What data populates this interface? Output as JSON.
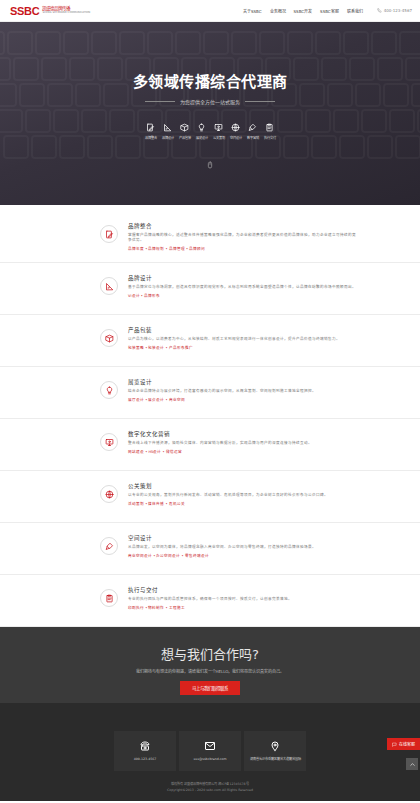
{
  "header": {
    "logo": "SSBC",
    "brand": "凯盛德品牌传播",
    "slogan": "SHENG SHI BRAND COMMUNICATION",
    "nav": [
      {
        "label": "关于SSBC"
      },
      {
        "label": "业务概况"
      },
      {
        "label": "SSBC开发"
      },
      {
        "label": "SSBC客服"
      },
      {
        "label": "联系我们"
      }
    ],
    "phone": "400-123-4567"
  },
  "hero": {
    "title": "多领域传播综合代理商",
    "subtitle": "为您提供全方位一站式服务",
    "services": [
      "品牌整合",
      "品牌设计",
      "产品包装",
      "展览设计",
      "公关策划",
      "空间设计",
      "数字营销",
      "执行交付"
    ]
  },
  "sections": [
    {
      "title": "品牌整合",
      "desc": "掌握客户品牌战略的核心，透过整合性传播策略来强化品牌，为企业和消费者提供更具价值的品牌体验，助力企业建立可持续的竞争优势。",
      "links": "品牌年度 • 品牌规划 • 品牌管理 • 品牌顾问"
    },
    {
      "title": "品牌设计",
      "desc": "基于品牌定位与市场洞察，创造具有辨识度的视觉形象，从标志到应用系统全面塑造品牌个性，让品牌在纷繁的市场中脱颖而出。",
      "links": "VI设计 • 品牌形象"
    },
    {
      "title": "产品包装",
      "desc": "以产品为核心，以消费者为中心，从包装结构、材质工艺到视觉表现进行一体化创意设计，提升产品价值与终端销售力。",
      "links": "包装策略 • 包装设计 • 产品形象推广"
    },
    {
      "title": "展览设计",
      "desc": "结合企业品牌特点与展会环境，打造富有感染力的展示空间，从概念策划、空间规划到施工落地全程把控。",
      "links": "展厅设计 • 展会设计 • 商业空间"
    },
    {
      "title": "数字化文化营销",
      "desc": "整合线上线下传播资源，借助社交媒体、内容营销与数据分析，实现品牌与用户的深度连接与持续互动。",
      "links": "网站建设 • H5设计 • 微信运营"
    },
    {
      "title": "公关策划",
      "desc": "以专业的公关视角，策划并执行新闻发布、活动营销、危机处理等项目，为企业树立良好的社会形象与公众口碑。",
      "links": "活动策划 • 媒体传播 • 危机公关"
    },
    {
      "title": "空间设计",
      "desc": "从品牌出发，以空间为载体，将品牌理念融入商业空间、办公空间与零售终端，打造独特的品牌体验场景。",
      "links": "商业空间设计 • 办公空间设计 • 零售终端设计"
    },
    {
      "title": "执行与交付",
      "desc": "专业的执行团队与严格的品质管控体系，确保每一个项目按时、按质交付，让创意完美落地。",
      "links": "印刷执行 • 物料制作 • 工程施工"
    }
  ],
  "cta": {
    "title": "想与我们合作吗?",
    "text": "我们期待与有想法的你相遇，请给我们发一个HELLO，我们将带您认识真实的自己。",
    "button": "马上与我们取得联系"
  },
  "footer": {
    "contacts": [
      "400-123-4567",
      "xxx@ssbcbrand.com",
      "湖南省长沙市岳麓区麓谷大道麓谷国际"
    ],
    "copyright": [
      "版权所有 凯盛德品牌传播有限公司 湘ICP备12345678号",
      "Copyright©2013 - 2020 ssbc.com All Rights Reserved"
    ]
  },
  "float": {
    "label": "在线客服"
  }
}
